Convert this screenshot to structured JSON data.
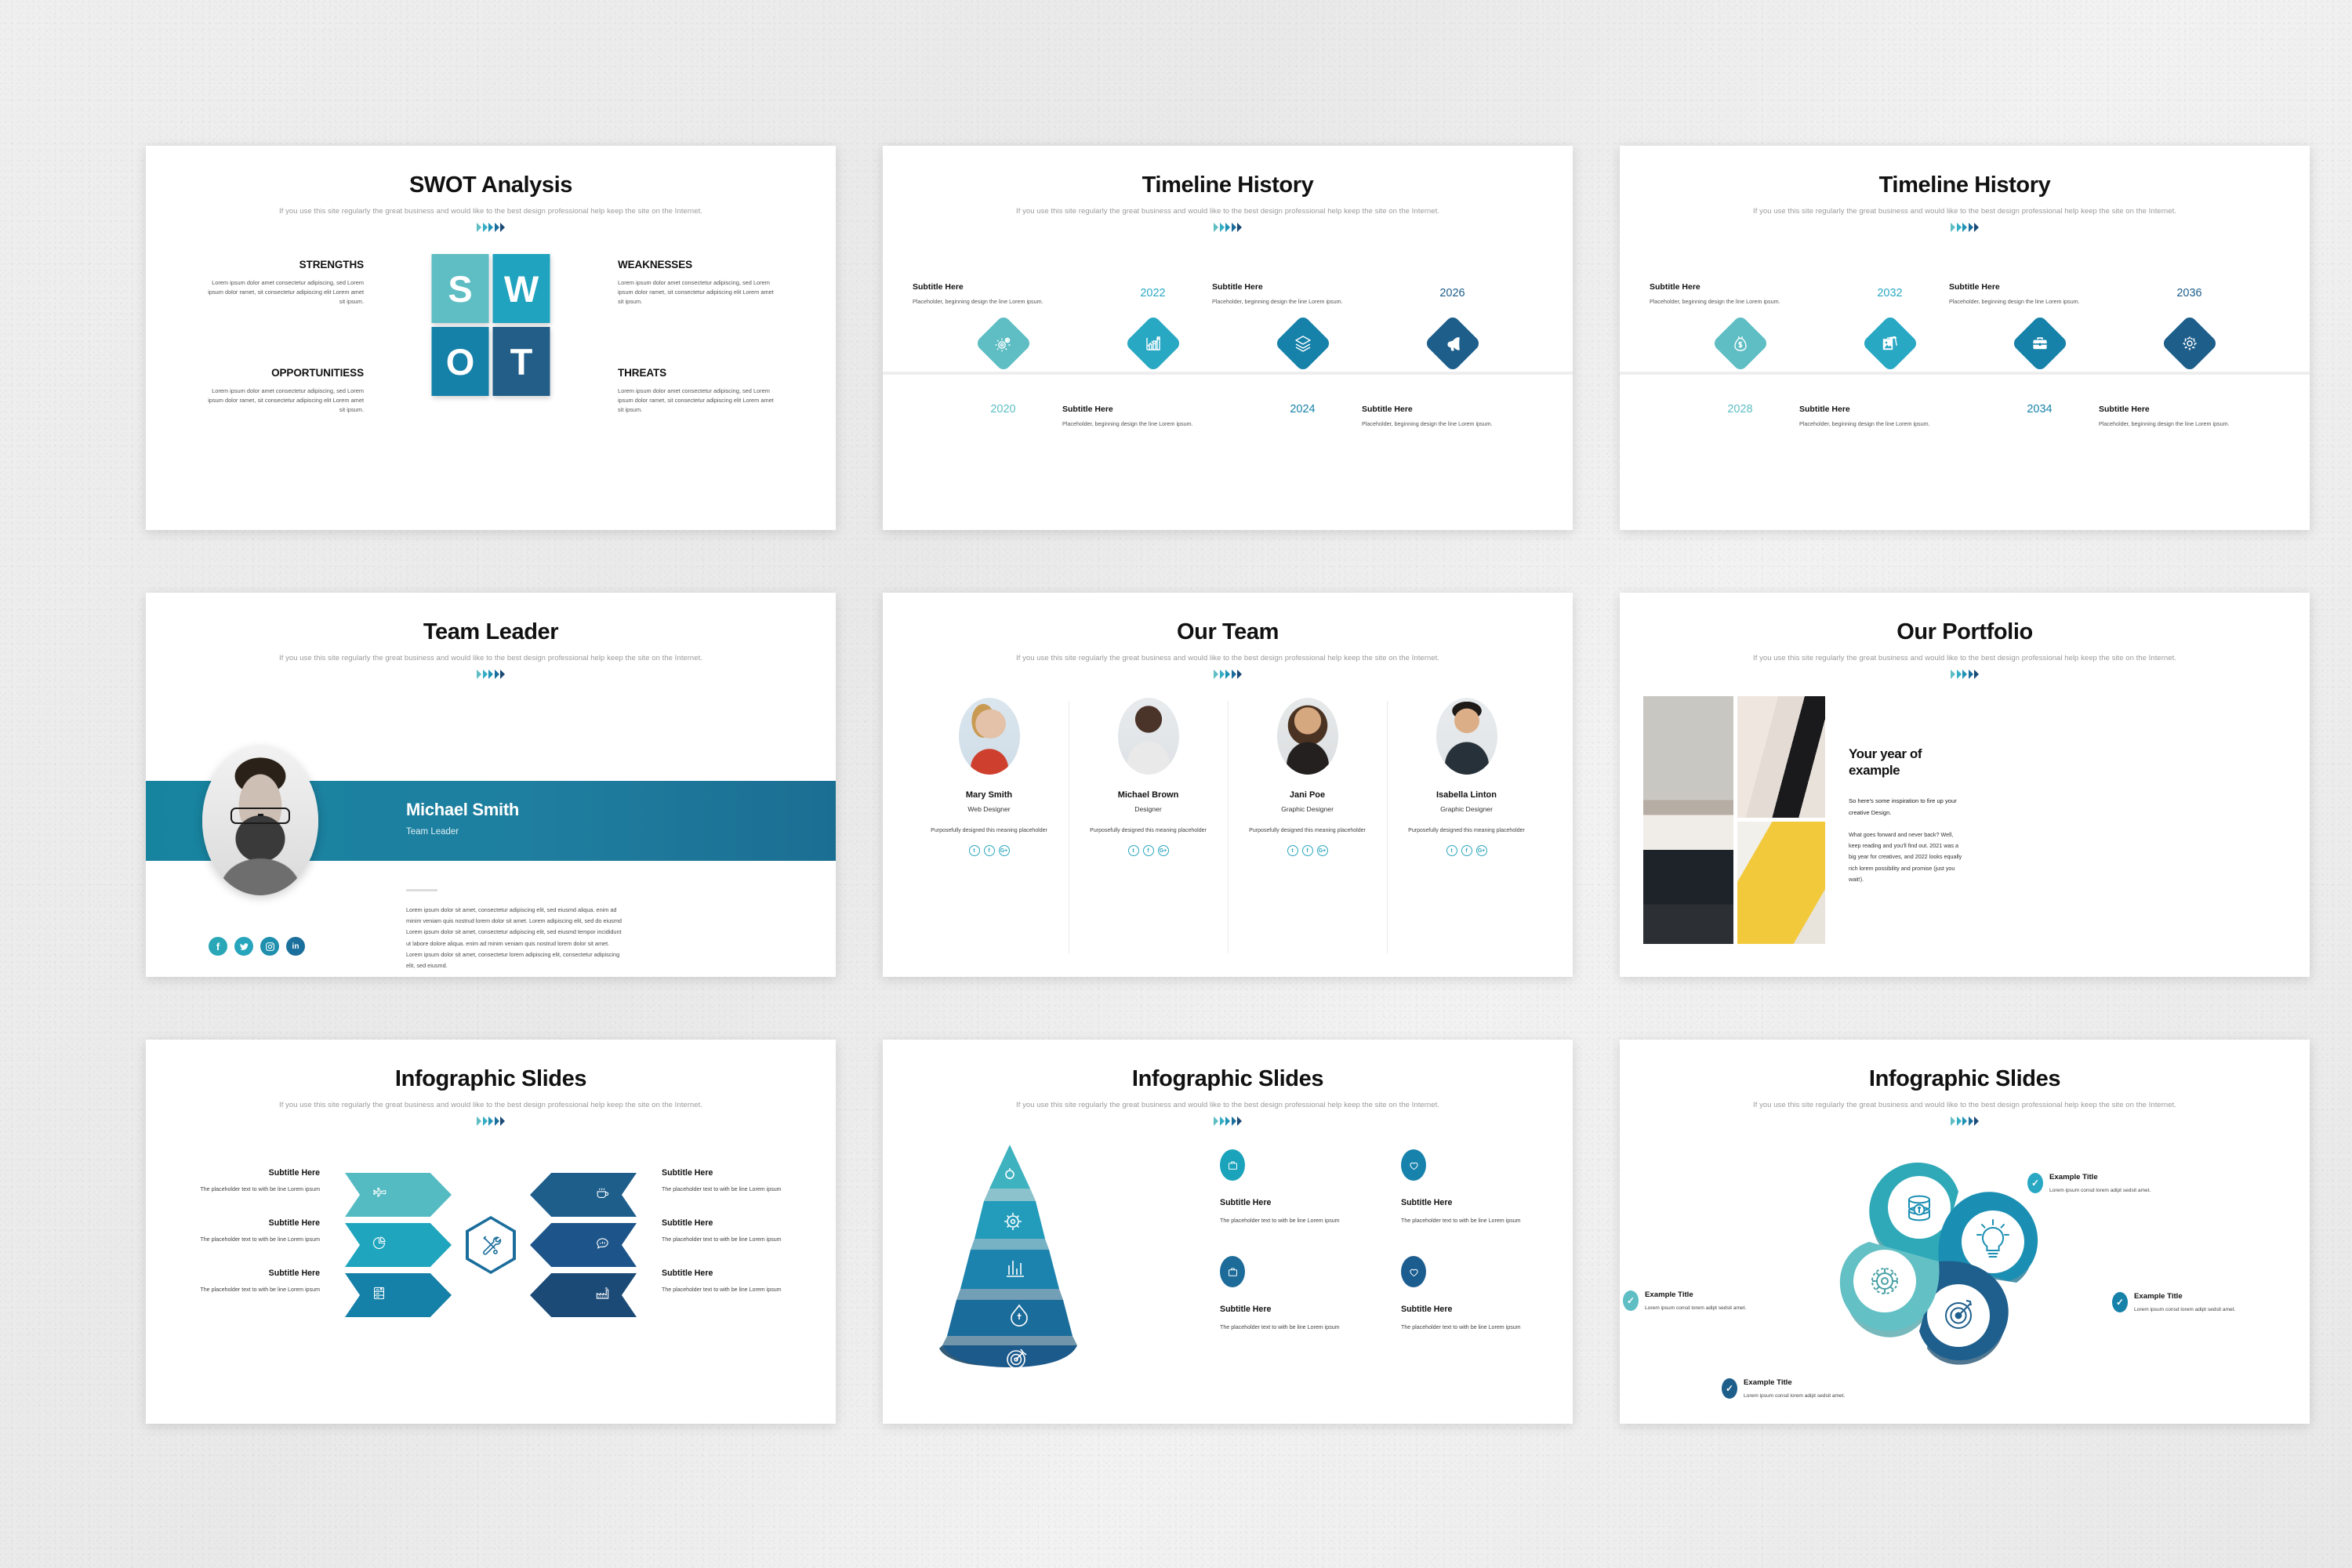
{
  "common": {
    "subtitle": "If you use this site regularly the great business and would like to the best design professional  help keep the site on the Internet.",
    "chevron_colors": [
      "#5fbec4",
      "#35aec5",
      "#1e93b6",
      "#1b6e9c",
      "#1b4a77"
    ]
  },
  "slides": {
    "swot": {
      "title": "SWOT Analysis",
      "letters": [
        "S",
        "W",
        "O",
        "T"
      ],
      "colors": [
        "#5fbec4",
        "#1fa3bf",
        "#1580a8",
        "#225e87"
      ],
      "quadrants": [
        {
          "heading": "STRENGTHS",
          "body": "Lorem ipsum dolor amet consectetur adipiscing, sed Lorem ipsum dolor ramet, sit consectetur adipiscing elit Lorem amet sit ipsum."
        },
        {
          "heading": "WEAKNESSES",
          "body": "Lorem ipsum dolor amet consectetur adipiscing, sed Lorem ipsum dolor ramet, sit consectetur adipiscing elit Lorem amet sit ipsum."
        },
        {
          "heading": "OPPORTUNITIESS",
          "body": "Lorem ipsum dolor amet consectetur adipiscing, sed Lorem ipsum dolor ramet, sit consectetur adipiscing elit Lorem amet sit ipsum."
        },
        {
          "heading": "THREATS",
          "body": "Lorem ipsum dolor amet consectetur adipiscing, sed Lorem ipsum dolor ramet, sit consectetur adipiscing elit Lorem amet sit ipsum."
        }
      ]
    },
    "timeline_a": {
      "title": "Timeline History",
      "items": [
        {
          "year": "2020",
          "heading": "Subtitle Here",
          "body": "Placeholder, beginning  design the line Lorem ipsum.",
          "icon": "gears-icon",
          "position": "top"
        },
        {
          "year": "2022",
          "heading": "Subtitle Here",
          "body": "Placeholder, beginning  design the line Lorem ipsum.",
          "icon": "growth-chart-icon",
          "position": "bottom"
        },
        {
          "year": "2024",
          "heading": "Subtitle Here",
          "body": "Placeholder, beginning  design the line Lorem ipsum.",
          "icon": "layers-icon",
          "position": "top"
        },
        {
          "year": "2026",
          "heading": "Subtitle Here",
          "body": "Placeholder, beginning  design the line Lorem ipsum.",
          "icon": "megaphone-icon",
          "position": "bottom"
        }
      ]
    },
    "timeline_b": {
      "title": "Timeline History",
      "items": [
        {
          "year": "2028",
          "heading": "Subtitle Here",
          "body": "Placeholder, beginning  design the line Lorem ipsum.",
          "icon": "money-bag-icon",
          "position": "top"
        },
        {
          "year": "2032",
          "heading": "Subtitle Here",
          "body": "Placeholder, beginning  design the line Lorem ipsum.",
          "icon": "photos-icon",
          "position": "bottom"
        },
        {
          "year": "2034",
          "heading": "Subtitle Here",
          "body": "Placeholder, beginning  design the line Lorem ipsum.",
          "icon": "briefcase-icon",
          "position": "top"
        },
        {
          "year": "2036",
          "heading": "Subtitle Here",
          "body": "Placeholder, beginning  design the line Lorem ipsum.",
          "icon": "gear-icon",
          "position": "bottom"
        }
      ]
    },
    "team_leader": {
      "title": "Team Leader",
      "name": "Michael Smith",
      "role": "Team Leader",
      "bio": "Lorem ipsum dolor sit amet, consectetur adipiscing elit, sed eiusmd aliqua. enim ad minim veniam quis  nostrud lorem dolor sit amet. Lorem adipiscing elit, sed  do eiusmd  Lorem ipsum dolor sit amet, consectetur  adipiscing elit, sed eiusmd tempor incididunt ut labore dolore aliqua. enim ad minim veniam quis nostrud lorem dolor sit amet. Lorem ipsum dolor sit amet, consectetur  lorem adipiscing elit, consectetur adipiscing elit, sed eiusmd.",
      "socials": [
        {
          "name": "facebook-icon",
          "glyph": "f",
          "color": "#2aa7b7"
        },
        {
          "name": "twitter-icon",
          "glyph": "ᵛ",
          "color": "#27a5bc"
        },
        {
          "name": "instagram-icon",
          "glyph": "□",
          "color": "#1f8fae"
        },
        {
          "name": "linkedin-icon",
          "glyph": "in",
          "color": "#1b6f9c"
        }
      ]
    },
    "our_team": {
      "title": "Our Team",
      "members": [
        {
          "name": "Mary Smith",
          "role": "Web Designer",
          "desc": "Purposefully designed this meaning placeholder"
        },
        {
          "name": "Michael Brown",
          "role": "Designer",
          "desc": "Purposefully designed this meaning placeholder"
        },
        {
          "name": "Jani Poe",
          "role": "Graphic Designer",
          "desc": "Purposefully designed this meaning placeholder"
        },
        {
          "name": "Isabella Linton",
          "role": "Graphic Designer",
          "desc": "Purposefully designed this meaning placeholder"
        }
      ],
      "social_glyphs": [
        "t",
        "f",
        "G+"
      ]
    },
    "portfolio": {
      "title": "Our Portfolio",
      "heading": "Your year of example",
      "lead": "So here's some inspiration to fire up your creative Design.",
      "body": "What goes forward and never  back? Well, keep reading and you'll find out. 2021 was a big year for creatives, and 2022 looks equally  rich lorem possibility and promise (just you wait!)."
    },
    "infographic_arrows": {
      "title": "Infographic Slides",
      "center_icon": "tools-icon",
      "left": [
        {
          "heading": "Subtitle Here",
          "body": "The placeholder text to with be line Lorem ipsum",
          "icon": "airplane-icon",
          "color": "#54bbc2"
        },
        {
          "heading": "Subtitle Here",
          "body": "The placeholder text to with be line Lorem ipsum",
          "icon": "pie-chart-icon",
          "color": "#1fa5bd"
        },
        {
          "heading": "Subtitle Here",
          "body": "The placeholder text to with be line Lorem ipsum",
          "icon": "server-icon",
          "color": "#1580a8"
        }
      ],
      "right": [
        {
          "heading": "Subtitle Here",
          "body": "The placeholder text to with be line Lorem ipsum",
          "icon": "coffee-cup-icon",
          "color": "#1d5e8b"
        },
        {
          "heading": "Subtitle Here",
          "body": "The placeholder text to with be line Lorem ipsum",
          "icon": "chat-chart-icon",
          "color": "#1d558a"
        },
        {
          "heading": "Subtitle Here",
          "body": "The placeholder text to with be line Lorem ipsum",
          "icon": "factory-icon",
          "color": "#1b4a77"
        }
      ]
    },
    "infographic_pyramid": {
      "title": "Infographic Slides",
      "pyramid_layers": [
        {
          "icon": "lightbulb-icon",
          "color": "#3fb2c0"
        },
        {
          "icon": "gear-icon",
          "color": "#229cba"
        },
        {
          "icon": "bar-chart-icon",
          "color": "#1b83ad"
        },
        {
          "icon": "money-bag-icon",
          "color": "#1a6c9b"
        },
        {
          "icon": "target-icon",
          "color": "#1d5a8c"
        }
      ],
      "items": [
        {
          "heading": "Subtitle Here",
          "body": "The placeholder  text to with be line Lorem ipsum",
          "icon": "briefcase-icon",
          "color": "#1ba3bb"
        },
        {
          "heading": "Subtitle Here",
          "body": "The placeholder  text to with be line Lorem ipsum",
          "icon": "heart-icon",
          "color": "#1782ac"
        },
        {
          "heading": "Subtitle Here",
          "body": "The placeholder  text to with be line Lorem ipsum",
          "icon": "briefcase-icon",
          "color": "#1c6b99"
        },
        {
          "heading": "Subtitle Here",
          "body": "The placeholder  text to with be line Lorem ipsum",
          "icon": "heart-icon",
          "color": "#1c5d90"
        }
      ]
    },
    "infographic_petals": {
      "title": "Infographic Slides",
      "petals": [
        {
          "position": "top",
          "icon": "coins-icon",
          "color": "#2fa9b8"
        },
        {
          "position": "right",
          "icon": "lightbulb-icon",
          "color": "#1b8fb3"
        },
        {
          "position": "bottom",
          "icon": "target-icon",
          "color": "#1f5f8d"
        },
        {
          "position": "left",
          "icon": "gear-icon",
          "color": "#63c0c4"
        }
      ],
      "callouts": [
        {
          "heading": "Example Title",
          "body": "Lorem ipsum consd lorem adipt sedsit amet.",
          "color": "#29a8c4"
        },
        {
          "heading": "Example Title",
          "body": "Lorem ipsum consd lorem adipt sedsit amet.",
          "color": "#1681a9"
        },
        {
          "heading": "Example Title",
          "body": "Lorem ipsum consd lorem adipt sedsit amet.",
          "color": "#1d5e8b"
        },
        {
          "heading": "Example Title",
          "body": "Lorem ipsum consd lorem adipt sedsit amet.",
          "color": "#5fbec4"
        }
      ]
    }
  }
}
